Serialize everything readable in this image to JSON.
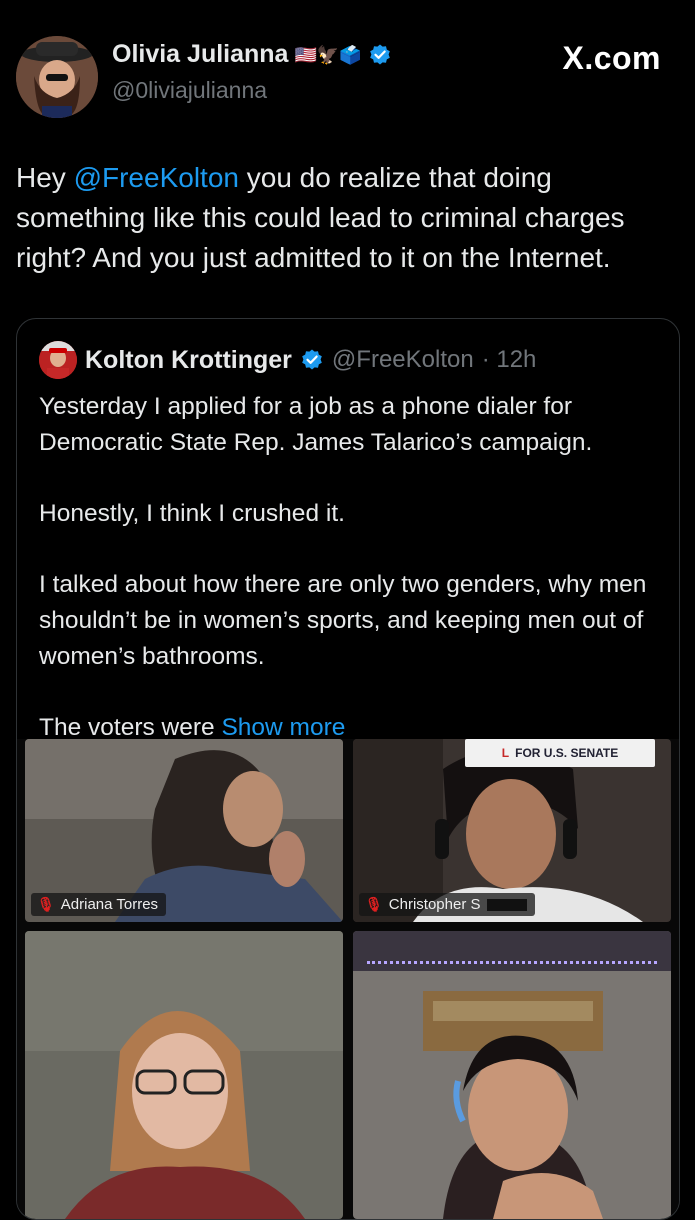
{
  "tweet": {
    "author_name": "Olivia Julianna",
    "author_emoji": "🇺🇸🦅🗳️",
    "author_handle": "@0liviajulianna",
    "site": "X.com",
    "mention": "@FreeKolton",
    "text_before": "Hey ",
    "text_after": " you do realize that doing something like this could lead to criminal charges right? And you just admitted to it on the Internet."
  },
  "quoted": {
    "author_name": "Kolton Krottinger",
    "author_handle": "@FreeKolton",
    "time": "· 12h",
    "paragraphs": [
      "Yesterday I applied for a job as a phone dialer for Democratic State Rep. James Talarico’s campaign.",
      "Honestly, I think I crushed it.",
      "I talked about how there are only two genders, why men shouldn’t be in women’s sports, and keeping men out of women’s bathrooms."
    ],
    "last_line_prefix": "The voters were ",
    "show_more": "Show more"
  },
  "video": {
    "participants": [
      {
        "name": "Adriana Torres"
      },
      {
        "name": "Christopher S"
      }
    ],
    "sign_text": "FOR U.S. SENATE"
  },
  "colors": {
    "accent": "#1d9bf0",
    "muted": "#71767b",
    "text": "#e7e9ea",
    "background": "#000000"
  }
}
